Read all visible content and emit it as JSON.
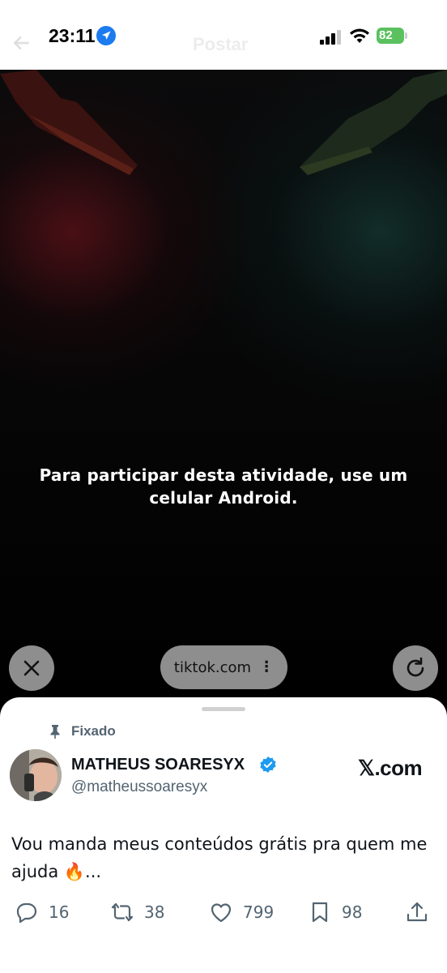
{
  "status_bar": {
    "time": "23:11",
    "battery": "82",
    "background_title": "Postar"
  },
  "video": {
    "message": "Para participar desta atividade, use um celular Android.",
    "url": "tiktok.com",
    "url_menu": "⋮"
  },
  "post": {
    "pinned_label": "Fixado",
    "author_name": "MATHEUS SOARESYX",
    "author_handle": "@matheussoaresyx",
    "source": "𝕏.com",
    "text": "Vou manda meus conteúdos grátis pra quem me ajuda 🔥...",
    "stats": {
      "replies": "16",
      "reposts": "38",
      "likes": "799",
      "bookmarks": "98"
    }
  },
  "colors": {
    "accent_blue": "#1d9bf0",
    "battery_green": "#5ac15e",
    "muted_text": "#536471"
  }
}
